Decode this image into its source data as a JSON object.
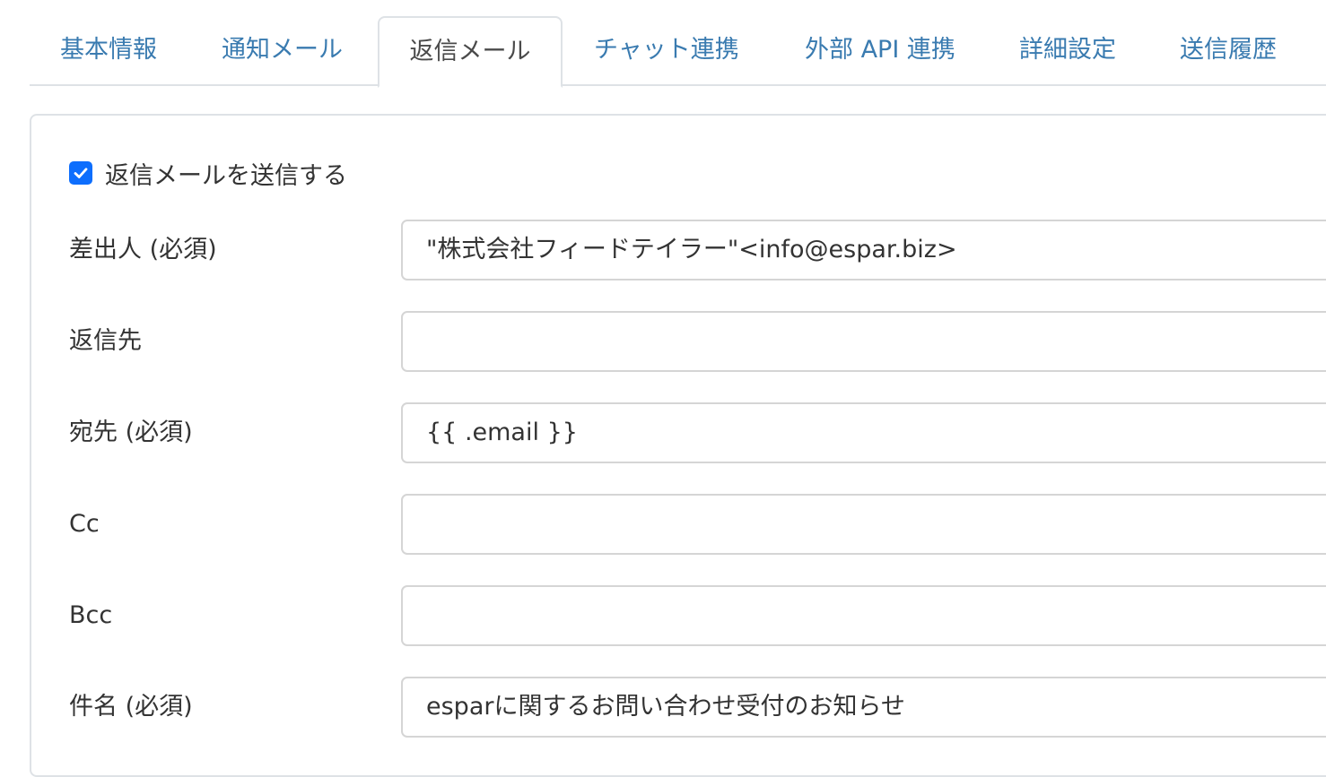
{
  "tabs": [
    {
      "label": "基本情報"
    },
    {
      "label": "通知メール"
    },
    {
      "label": "返信メール"
    },
    {
      "label": "チャット連携"
    },
    {
      "label": "外部 API 連携"
    },
    {
      "label": "詳細設定"
    },
    {
      "label": "送信履歴"
    }
  ],
  "active_tab": "返信メール",
  "send_reply": {
    "label": "返信メールを送信する",
    "checked": true
  },
  "fields": {
    "from": {
      "label": "差出人 (必須)",
      "value": "\"株式会社フィードテイラー\"<info@espar.biz>"
    },
    "reply_to": {
      "label": "返信先",
      "value": ""
    },
    "to": {
      "label": "宛先 (必須)",
      "value": "{{ .email }}"
    },
    "cc": {
      "label": "Cc",
      "value": ""
    },
    "bcc": {
      "label": "Bcc",
      "value": ""
    },
    "subject": {
      "label": "件名 (必須)",
      "value": "esparに関するお問い合わせ受付のお知らせ"
    }
  },
  "colors": {
    "accent": "#0d6efd",
    "tab_link": "#3a7bb0",
    "border": "#dee2e6"
  }
}
